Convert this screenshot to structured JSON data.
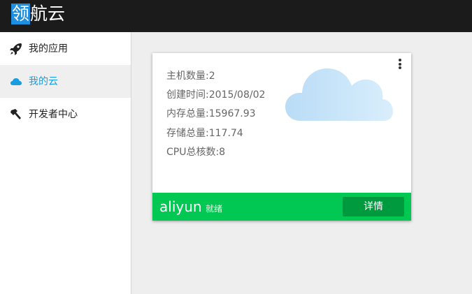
{
  "app": {
    "logo_mark": "领",
    "logo_rest": "航云"
  },
  "sidebar": {
    "items": [
      {
        "label": "我的应用",
        "icon": "rocket-icon",
        "active": false
      },
      {
        "label": "我的云",
        "icon": "cloud-icon",
        "active": true
      },
      {
        "label": "开发者中心",
        "icon": "hammer-icon",
        "active": false
      }
    ]
  },
  "card": {
    "details": [
      "主机数量:2",
      "创建时间:2015/08/02",
      "内存总量:15967.93",
      "存储总量:117.74",
      "CPU总核数:8"
    ],
    "name": "aliyun",
    "status": "就绪",
    "detail_button": "详情",
    "more_icon": "more-vert-icon",
    "illustration": "cloud-illustration"
  },
  "colors": {
    "topbar": "#1b1b1b",
    "logo_accent": "#1e8fe0",
    "active_nav": "#1a9de0",
    "card_footer": "#00c853",
    "detail_button": "#009a3e"
  }
}
